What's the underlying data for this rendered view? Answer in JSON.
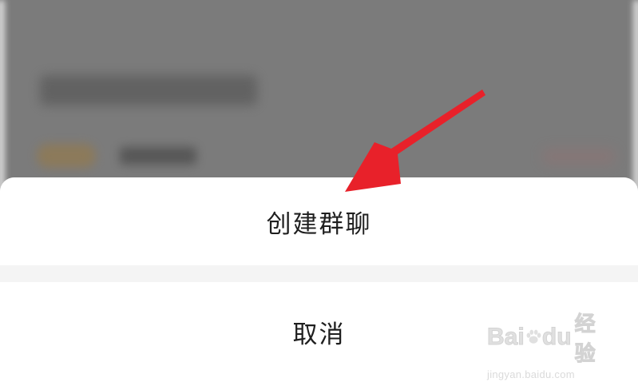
{
  "action_sheet": {
    "create_group_label": "创建群聊",
    "cancel_label": "取消"
  },
  "annotation": {
    "arrow_color": "#e8212a"
  },
  "watermark": {
    "logo_text": "Bai du 经验",
    "url": "jingyan.baidu.com"
  },
  "colors": {
    "overlay": "#7b7b7b",
    "sheet": "#ffffff",
    "separator": "#f4f4f4",
    "text": "#1f1f1f"
  }
}
